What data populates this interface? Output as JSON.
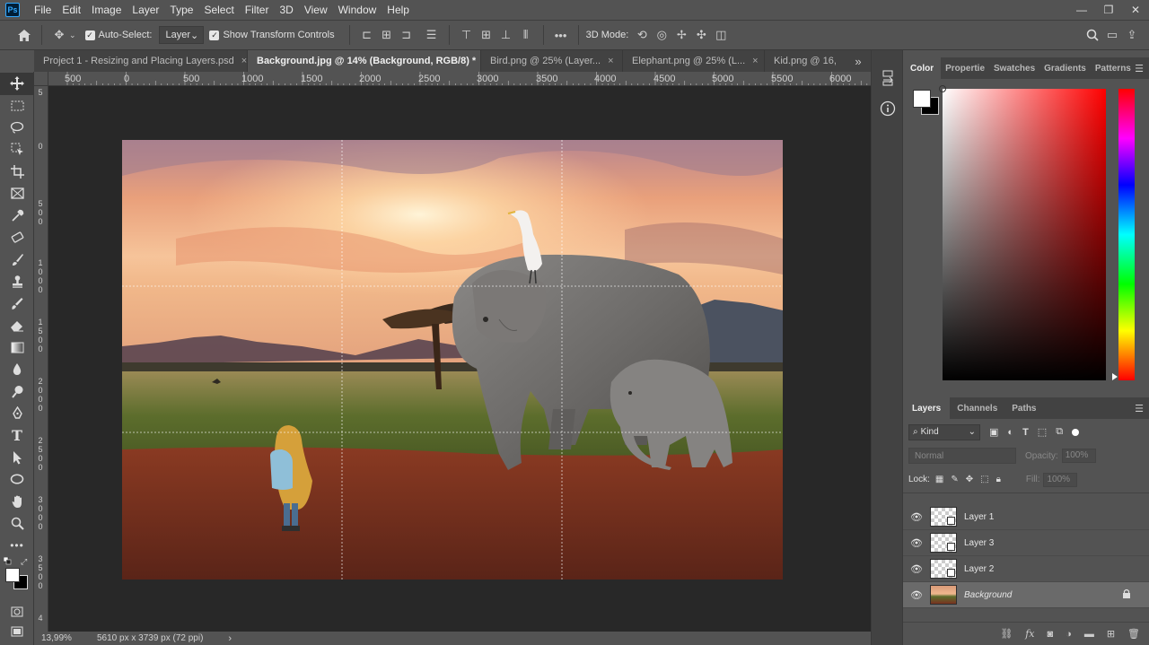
{
  "app": {
    "logo": "Ps",
    "menu": [
      "File",
      "Edit",
      "Image",
      "Layer",
      "Type",
      "Select",
      "Filter",
      "3D",
      "View",
      "Window",
      "Help"
    ],
    "window_controls": [
      "minimize-icon",
      "restore-icon",
      "close-icon"
    ]
  },
  "options_bar": {
    "auto_select_label": "Auto-Select:",
    "auto_select_checked": true,
    "auto_select_target": "Layer",
    "show_transform_label": "Show Transform Controls",
    "show_transform_checked": true,
    "more_label": "•••",
    "mode_3d_label": "3D Mode:"
  },
  "tabs": [
    {
      "label": "Project 1 - Resizing and Placing Layers.psd",
      "active": false
    },
    {
      "label": "Background.jpg @ 14% (Background, RGB/8) *",
      "active": true
    },
    {
      "label": "Bird.png @ 25% (Layer...",
      "active": false
    },
    {
      "label": "Elephant.png @ 25% (L...",
      "active": false
    },
    {
      "label": "Kid.png @ 16,",
      "active": false
    }
  ],
  "tab_overflow": "»",
  "ruler_h": [
    {
      "label": "500"
    },
    {
      "label": "0"
    },
    {
      "label": "500"
    },
    {
      "label": "1000"
    },
    {
      "label": "1500"
    },
    {
      "label": "2000"
    },
    {
      "label": "2500"
    },
    {
      "label": "3000"
    },
    {
      "label": "3500"
    },
    {
      "label": "4000"
    },
    {
      "label": "4500"
    },
    {
      "label": "5000"
    },
    {
      "label": "5500"
    },
    {
      "label": "6000"
    }
  ],
  "ruler_v": [
    "5",
    "0",
    "5\n0\n0",
    "1\n0\n0\n0",
    "1\n5\n0\n0",
    "2\n0\n0\n0",
    "2\n5\n0\n0",
    "3\n0\n0\n0",
    "3\n5\n0\n0",
    "4"
  ],
  "status": {
    "zoom": "13,99%",
    "doc_size": "5610 px x 3739 px (72 ppi)",
    "arrow": "›"
  },
  "color_panel": {
    "tabs": [
      "Color",
      "Propertie",
      "Swatches",
      "Gradients",
      "Patterns"
    ],
    "active_tab": "Color",
    "foreground": "#ffffff",
    "background": "#000000",
    "hue_color": "#ff0000"
  },
  "layers_panel": {
    "tabs": [
      "Layers",
      "Channels",
      "Paths"
    ],
    "active_tab": "Layers",
    "filter_kind": "Kind",
    "blend_mode": "Normal",
    "opacity_label": "Opacity:",
    "opacity_value": "100%",
    "lock_label": "Lock:",
    "fill_label": "Fill:",
    "fill_value": "100%",
    "layers": [
      {
        "name": "Layer 1",
        "visible": true,
        "selected": false,
        "locked": false
      },
      {
        "name": "Layer 3",
        "visible": true,
        "selected": false,
        "locked": false
      },
      {
        "name": "Layer 2",
        "visible": true,
        "selected": false,
        "locked": false
      },
      {
        "name": "Background",
        "visible": true,
        "selected": true,
        "locked": true
      }
    ],
    "footer_icons": [
      "link-icon",
      "fx-icon",
      "mask-icon",
      "adjustment-icon",
      "folder-icon",
      "new-layer-icon",
      "trash-icon"
    ]
  },
  "tools": [
    "move-tool",
    "marquee-tool",
    "lasso-tool",
    "object-select-tool",
    "crop-tool",
    "frame-tool",
    "eyedropper-tool",
    "spot-heal-tool",
    "brush-tool",
    "stamp-tool",
    "history-brush-tool",
    "eraser-tool",
    "gradient-tool",
    "blur-tool",
    "dodge-tool",
    "pen-tool",
    "type-tool",
    "path-select-tool",
    "ellipse-tool",
    "hand-tool",
    "zoom-tool",
    "more-tools"
  ]
}
